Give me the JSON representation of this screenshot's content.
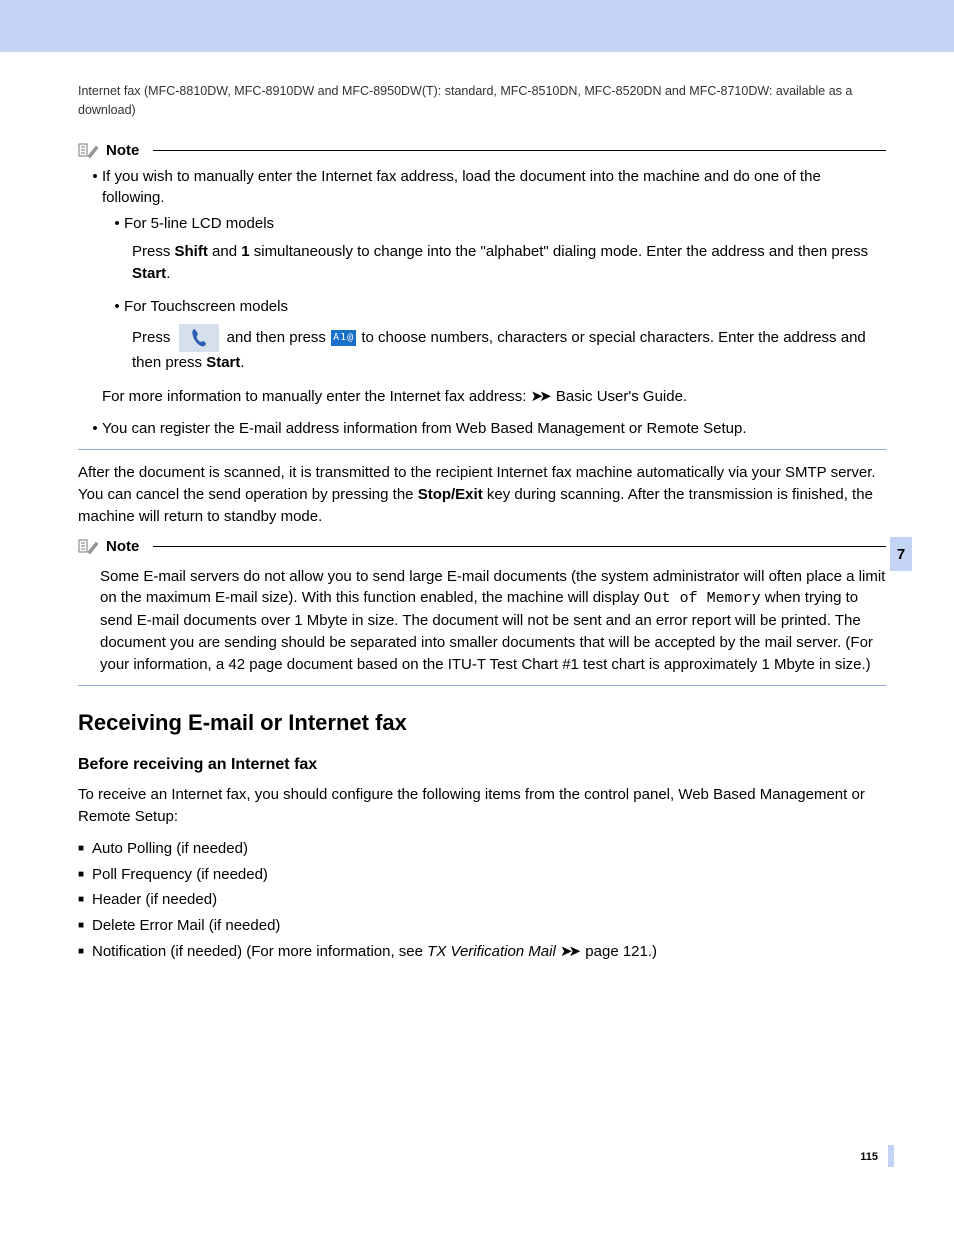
{
  "header": "Internet fax (MFC-8810DW, MFC-8910DW and MFC-8950DW(T): standard, MFC-8510DN, MFC-8520DN and MFC-8710DW: available as a download)",
  "note_label": "Note",
  "note1": {
    "bullet1_a": "If you wish to manually enter the Internet fax address, load the document into the machine and do one of the following.",
    "sub_a_label": "For 5-line LCD models",
    "sub_a_body_1": "Press ",
    "sub_a_body_shift": "Shift",
    "sub_a_body_2": " and ",
    "sub_a_body_one": "1",
    "sub_a_body_3": " simultaneously to change into the \"alphabet\" dialing mode. Enter the address and then press ",
    "sub_a_body_start": "Start",
    "sub_a_body_4": ".",
    "sub_b_label": "For Touchscreen models",
    "sub_b_press1": "Press ",
    "sub_b_press2": " and then press ",
    "sub_b_key": "A1@",
    "sub_b_press3": " to choose numbers, characters or special characters. Enter the address and then press ",
    "sub_b_start": "Start",
    "sub_b_end": ".",
    "more_info_a": "For more information to manually enter the Internet fax address: ",
    "more_info_b": " Basic User's Guide.",
    "bullet2": "You can register the E-mail address information from Web Based Management or Remote Setup."
  },
  "body_para_a": "After the document is scanned, it is transmitted to the recipient Internet fax machine automatically via your SMTP server. You can cancel the send operation by pressing the ",
  "body_para_key": "Stop/Exit",
  "body_para_b": " key during scanning. After the transmission is finished, the machine will return to standby mode.",
  "side_tab": "7",
  "note2_a": "Some E-mail servers do not allow you to send large E-mail documents (the system administrator will often place a limit on the maximum E-mail size). With this function enabled, the machine will display ",
  "note2_mono": "Out of Memory",
  "note2_b": " when trying to send E-mail documents over 1 Mbyte in size. The document will not be sent and an error report will be printed. The document you are sending should be separated into smaller documents that will be accepted by the mail server. (For your information, a 42 page document based on the ITU-T Test Chart #1 test chart is approximately 1 Mbyte in size.)",
  "section_h2": "Receiving E-mail or Internet fax",
  "section_h3": "Before receiving an Internet fax",
  "section_intro": "To receive an Internet fax, you should configure the following items from the control panel, Web Based Management or Remote Setup:",
  "list": {
    "i1": "Auto Polling (if needed)",
    "i2": "Poll Frequency (if needed)",
    "i3": "Header (if needed)",
    "i4": "Delete Error Mail (if needed)",
    "i5_a": "Notification (if needed) (For more information, see ",
    "i5_italic": "TX Verification Mail",
    "i5_b": " page 121.)"
  },
  "page_number": "115"
}
